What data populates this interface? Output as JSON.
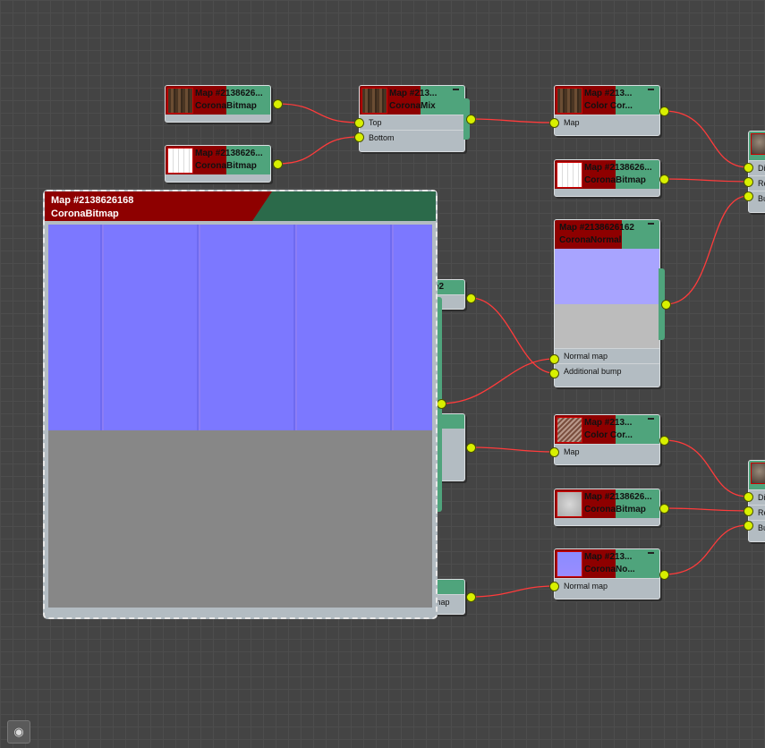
{
  "nodes": {
    "wood_bitmap": {
      "title": "Map #2138626...",
      "type": "CoronaBitmap"
    },
    "white_bitmap": {
      "title": "Map #2138626...",
      "type": "CoronaBitmap"
    },
    "mix": {
      "title": "Map #213...",
      "type": "CoronaMix",
      "slots": [
        "Top",
        "Bottom"
      ]
    },
    "cc1": {
      "title": "Map #213...",
      "type": "Color Cor...",
      "slots": [
        "Map"
      ]
    },
    "bitmap2": {
      "title": "Map #2138626...",
      "type": "CoronaBitmap"
    },
    "normal1": {
      "title": "Map #2138626162",
      "type": "CoronaNormal",
      "slots": [
        "Normal map",
        "Additional bump"
      ]
    },
    "cc2": {
      "title": "Map #213...",
      "type": "Color Cor...",
      "slots": [
        "Map"
      ]
    },
    "bitmap3": {
      "title": "Map #2138626...",
      "type": "CoronaBitmap"
    },
    "normal2": {
      "title": "Map #213...",
      "type": "CoronaNo...",
      "slots": [
        "Normal map"
      ]
    },
    "mat1": {
      "slots": [
        "Di",
        "Re",
        "Bu"
      ]
    },
    "mat2": {
      "slots": [
        "Di",
        "Re",
        "Bu"
      ]
    },
    "hidden1": {
      "title_frag": "e2",
      "slot_frag": "p"
    },
    "hidden2": {
      "slot_frag": "map"
    }
  },
  "preview": {
    "title": "Map #2138626168",
    "type": "CoronaBitmap"
  },
  "colors": {
    "wire": "#ff3b3b",
    "socket": "#d8f000",
    "header_green": "#4fa47c",
    "header_red": "#8e0000"
  },
  "toolbar": {
    "fit_icon": "binoculars-icon"
  }
}
